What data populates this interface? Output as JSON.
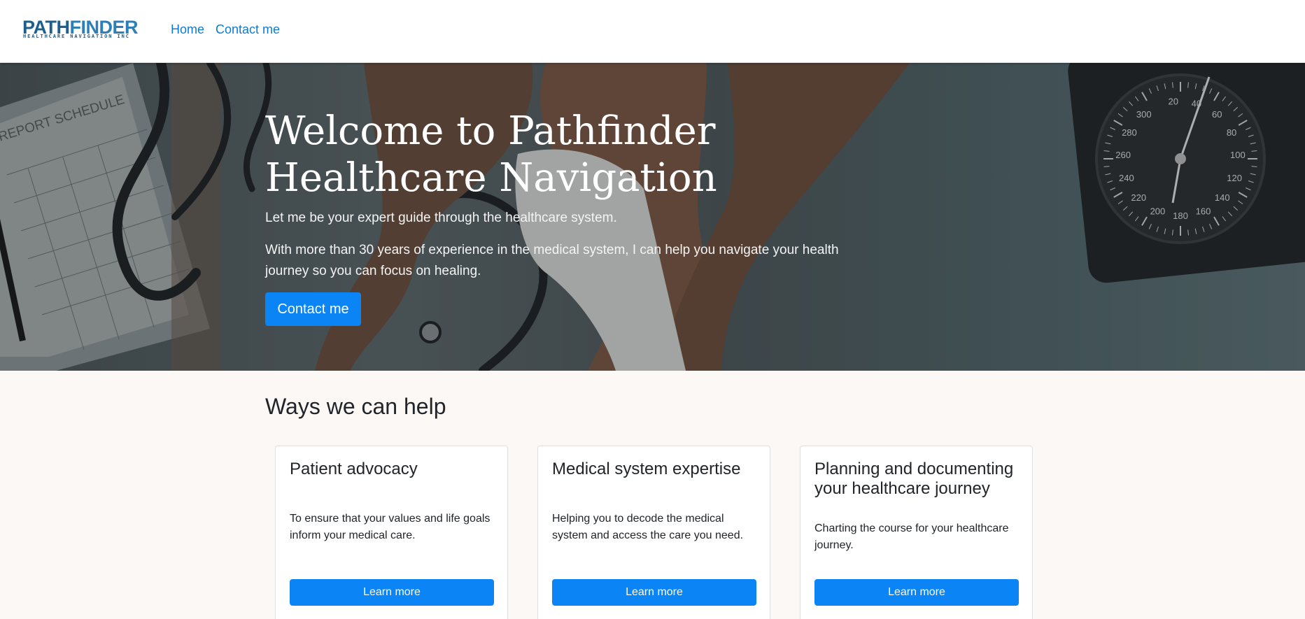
{
  "brand": {
    "logo_text_dark": "PATH",
    "logo_text_light": "FINDER",
    "logo_tagline": "HEALTHCARE NAVIGATION INC",
    "primary_color": "#0b84f5",
    "logo_dark_color": "#1f5f8b",
    "logo_light_color": "#2c7fb8"
  },
  "nav": {
    "items": [
      {
        "label": "Home"
      },
      {
        "label": "Contact me"
      }
    ]
  },
  "hero": {
    "title": "Welcome to Pathfinder Healthcare Navigation",
    "subtitle": "Let me be your expert guide through the healthcare system.",
    "body": "With more than 30 years of experience in the medical system, I can help you navigate your health journey so you can focus on healing.",
    "cta_label": "Contact me",
    "image_text": {
      "clipboard": "REPORT SCHEDULE",
      "gauge_numbers": [
        "300",
        "280",
        "260",
        "240",
        "220",
        "200",
        "180",
        "160",
        "140",
        "120",
        "100",
        "80",
        "60",
        "40",
        "20"
      ]
    }
  },
  "services": {
    "heading": "Ways we can help",
    "cards": [
      {
        "title": "Patient advocacy",
        "text": "To ensure that your values and life goals inform your medical care.",
        "button": "Learn more"
      },
      {
        "title": "Medical system expertise",
        "text": "Helping you to decode the medical system and access the care you need.",
        "button": "Learn more"
      },
      {
        "title": "Planning and documenting your healthcare journey",
        "text": "Charting the course for your healthcare journey.",
        "button": "Learn more"
      }
    ]
  }
}
